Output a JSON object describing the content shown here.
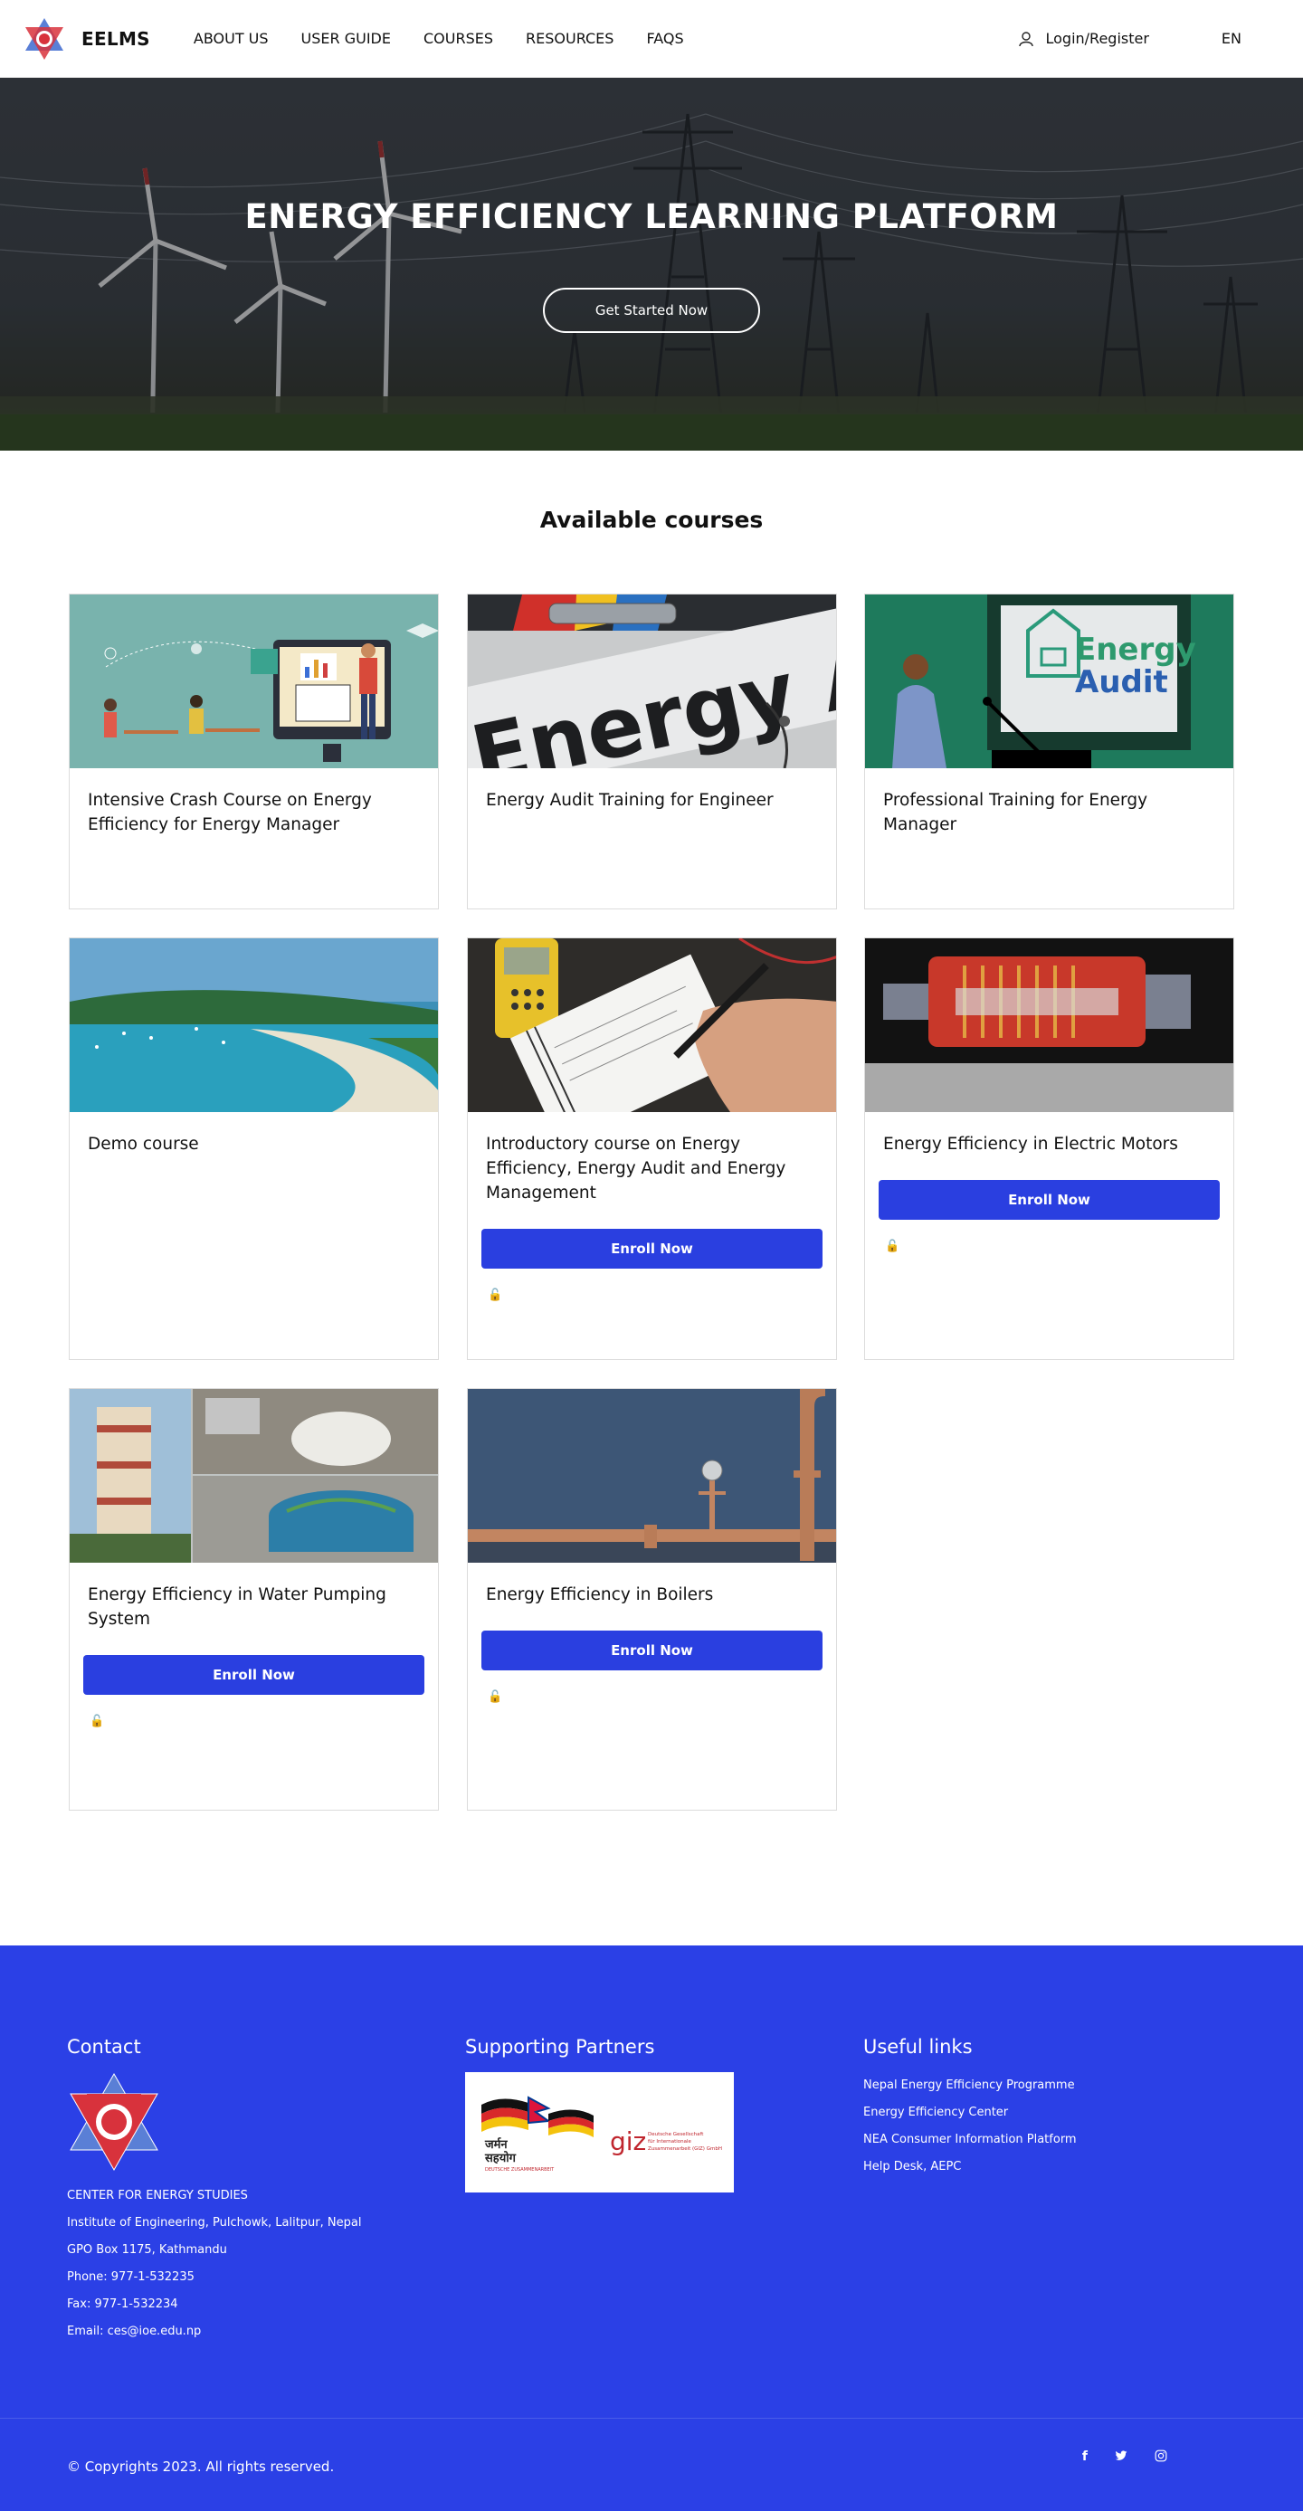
{
  "nav": {
    "brand": "EELMS",
    "menu": [
      "ABOUT US",
      "USER GUIDE",
      "COURSES",
      "RESOURCES",
      "FAQS"
    ],
    "login": "Login/Register",
    "lang": "EN"
  },
  "hero": {
    "title": "ENERGY EFFICIENCY LEARNING PLATFORM",
    "button": "Get Started Now"
  },
  "courses": {
    "heading": "Available courses",
    "enroll_label": "Enroll Now",
    "items": [
      {
        "title": "Intensive Crash Course on Energy Efficiency for Energy Manager"
      },
      {
        "title": "Energy Audit Training for Engineer"
      },
      {
        "title": "Professional Training for Energy Manager"
      },
      {
        "title": "Demo course"
      },
      {
        "title": "Introductory course on Energy Efficiency, Energy Audit and Energy Management"
      },
      {
        "title": "Energy Efficiency in Electric Motors"
      },
      {
        "title": "Energy Efficiency in Water Pumping System"
      },
      {
        "title": "Energy Efficiency in Boilers"
      }
    ],
    "image_text": {
      "audit_banner": "Energy Audit",
      "audit_board_line1": "Energy",
      "audit_board_line2": "Audit"
    }
  },
  "footer": {
    "contact_heading": "Contact",
    "contact_lines": [
      "CENTER FOR ENERGY STUDIES",
      "Institute of Engineering, Pulchowk, Lalitpur, Nepal",
      "GPO Box 1175, Kathmandu",
      "Phone: 977-1-532235",
      "Fax: 977-1-532234",
      "Email: ces@ioe.edu.np"
    ],
    "partners_heading": "Supporting Partners",
    "partner_text": {
      "german_line1": "जर्मन",
      "german_line2": "सहयोग",
      "german_sub": "DEUTSCHE ZUSAMMENARBEIT",
      "giz": "giz",
      "giz_sub1": "Deutsche Gesellschaft",
      "giz_sub2": "für Internationale",
      "giz_sub3": "Zusammenarbeit (GIZ) GmbH"
    },
    "links_heading": "Useful links",
    "links": [
      "Nepal Energy Efficiency Programme",
      "Energy Efficiency Center",
      "NEA Consumer Information Platform",
      "Help Desk, AEPC"
    ],
    "copyright": "© Copyrights 2023. All rights reserved.",
    "social": [
      "facebook-icon",
      "twitter-icon",
      "instagram-icon"
    ]
  },
  "colors": {
    "accent": "#2b40e6",
    "button": "#2a3fe0"
  }
}
